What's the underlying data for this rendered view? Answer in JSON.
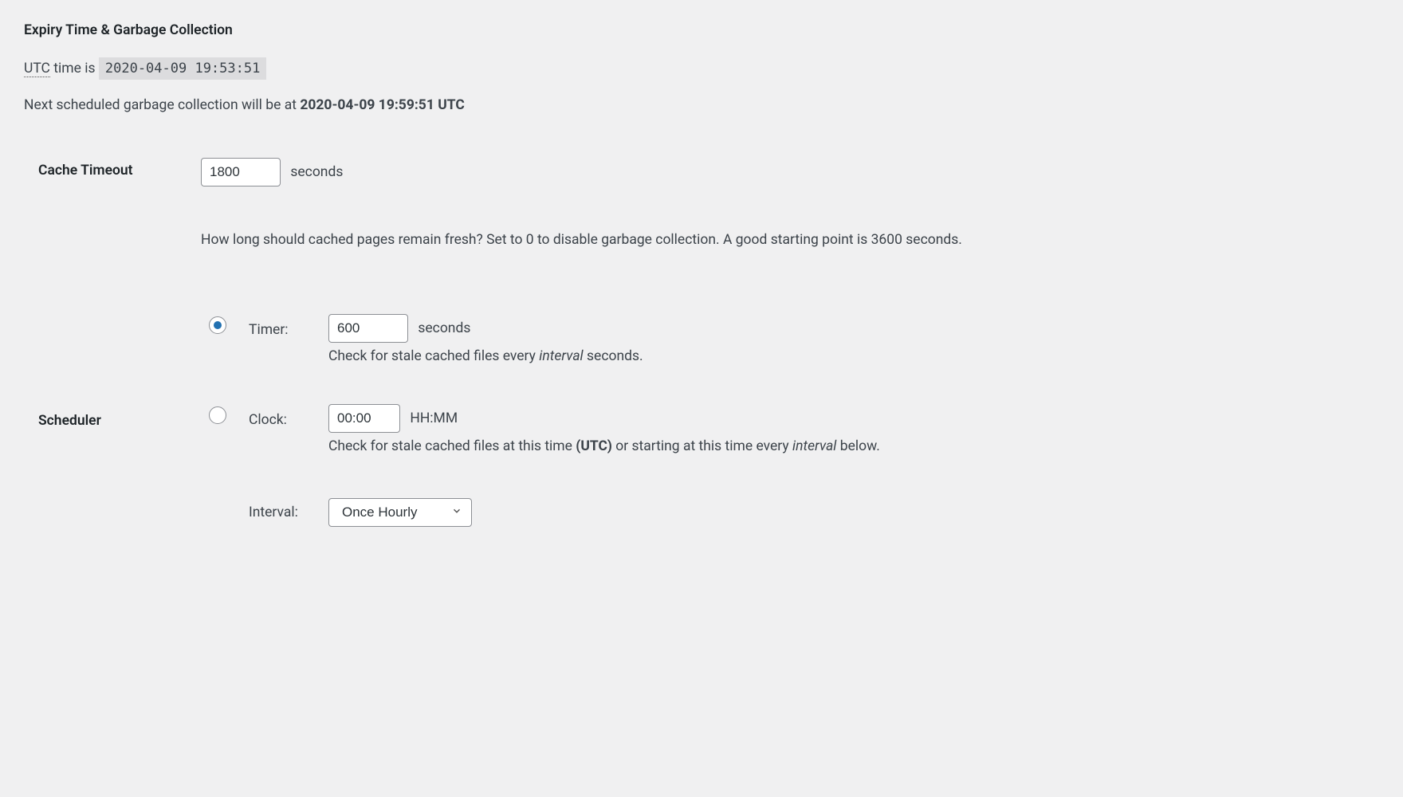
{
  "section": {
    "title": "Expiry Time & Garbage Collection"
  },
  "utc": {
    "abbr": "UTC",
    "prefix": " time is ",
    "current": "2020-04-09 19:53:51"
  },
  "nextGc": {
    "prefix": "Next scheduled garbage collection will be at ",
    "time": "2020-04-09 19:59:51 UTC"
  },
  "cacheTimeout": {
    "label": "Cache Timeout",
    "value": "1800",
    "unit": "seconds",
    "help": "How long should cached pages remain fresh? Set to 0 to disable garbage collection. A good starting point is 3600 seconds."
  },
  "scheduler": {
    "label": "Scheduler",
    "timer": {
      "optionLabel": "Timer:",
      "value": "600",
      "unit": "seconds",
      "descPrefix": "Check for stale cached files every ",
      "descInterval": "interval",
      "descSuffix": " seconds."
    },
    "clock": {
      "optionLabel": "Clock:",
      "value": "00:00",
      "unit": "HH:MM",
      "descPrefix": "Check for stale cached files at this time ",
      "descBold": "(UTC)",
      "descMiddle": " or starting at this time every ",
      "descInterval": "interval",
      "descSuffix": " below."
    },
    "interval": {
      "label": "Interval:",
      "selected": "Once Hourly"
    }
  }
}
